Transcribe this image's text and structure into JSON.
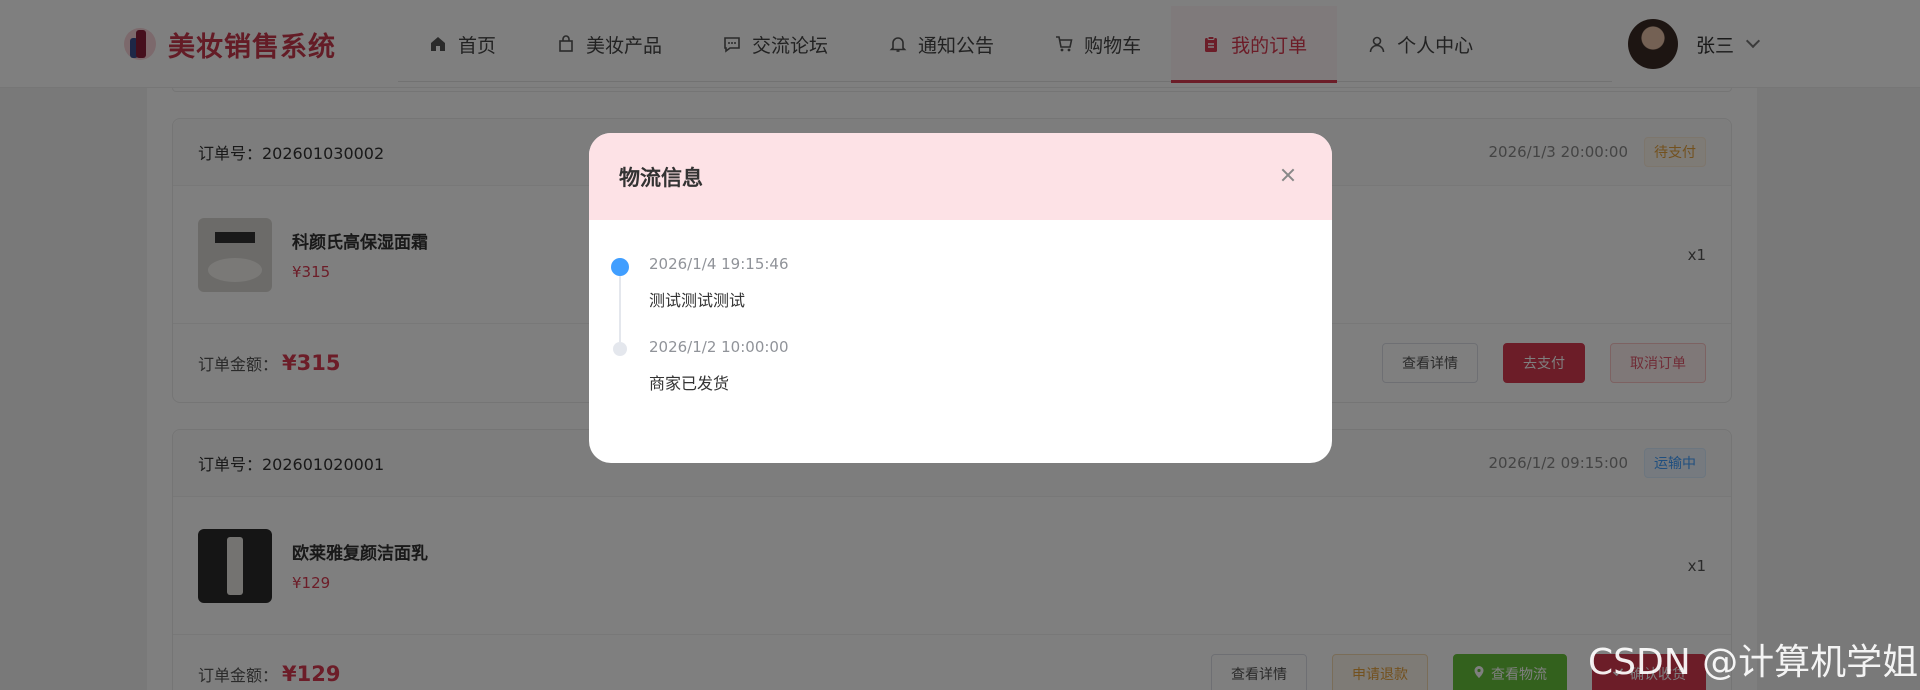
{
  "app": {
    "title": "美妆销售系统"
  },
  "nav": [
    {
      "label": "首页",
      "icon": "home-icon"
    },
    {
      "label": "美妆产品",
      "icon": "shopping-bag-icon"
    },
    {
      "label": "交流论坛",
      "icon": "chat-icon"
    },
    {
      "label": "通知公告",
      "icon": "bell-icon"
    },
    {
      "label": "购物车",
      "icon": "cart-icon"
    },
    {
      "label": "我的订单",
      "icon": "clipboard-icon",
      "active": true
    },
    {
      "label": "个人中心",
      "icon": "user-icon"
    }
  ],
  "user": {
    "name": "张三"
  },
  "orders": [
    {
      "no_label": "订单号：202601030002",
      "time": "2026/1/3 20:00:00",
      "status": "待支付",
      "item": {
        "name": "科颜氏高保湿面霜",
        "price": "¥315",
        "qty": "x1"
      },
      "amount_label": "订单金额：",
      "amount": "¥315",
      "actions": [
        "查看详情",
        "去支付",
        "取消订单"
      ]
    },
    {
      "no_label": "订单号：202601020001",
      "time": "2026/1/2 09:15:00",
      "status": "运输中",
      "item": {
        "name": "欧莱雅复颜洁面乳",
        "price": "¥129",
        "qty": "x1"
      },
      "amount_label": "订单金额：",
      "amount": "¥129",
      "actions": [
        "查看详情",
        "申请退款",
        "查看物流",
        "确认收货"
      ]
    }
  ],
  "dialog": {
    "title": "物流信息",
    "timeline": [
      {
        "time": "2026/1/4 19:15:46",
        "text": "测试测试测试"
      },
      {
        "time": "2026/1/2 10:00:00",
        "text": "商家已发货"
      }
    ]
  },
  "watermark": "CSDN @计算机学姐",
  "colors": {
    "accent": "#d93a51",
    "dialog_header": "#fde2e6",
    "timeline_active": "#409eff"
  }
}
